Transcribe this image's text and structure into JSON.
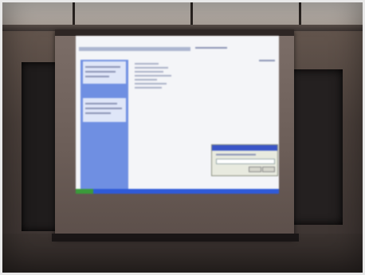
{
  "scene": {
    "subject": "",
    "colors": {
      "screen_case": "#6b5d57",
      "desktop_background": "#f4f5f8",
      "task_pane": "#6f8fe2",
      "taskbar": "#2f5ad8",
      "start_button": "#3a9b3a",
      "dialog_titlebar": "#3a55c8"
    }
  }
}
